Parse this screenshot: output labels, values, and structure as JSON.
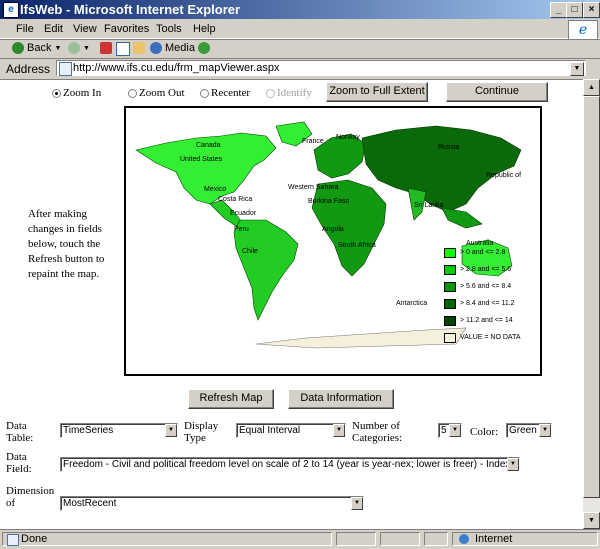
{
  "window": {
    "title": "IfsWeb - Microsoft Internet Explorer",
    "min": "_",
    "max": "□",
    "close": "×"
  },
  "menu": [
    "File",
    "Edit",
    "View",
    "Favorites",
    "Tools",
    "Help"
  ],
  "toolbar": {
    "back": "Back",
    "media": "Media"
  },
  "address": {
    "label": "Address",
    "url": "http://www.ifs.cu.edu/frm_mapViewer.aspx"
  },
  "mode": {
    "zoom_in": "Zoom In",
    "zoom_out": "Zoom Out",
    "recenter": "Recenter",
    "identify": "Identify",
    "selected": "zoom_in"
  },
  "buttons": {
    "full_extent": "Zoom to Full Extent",
    "continue": "Continue",
    "refresh": "Refresh Map",
    "data_info": "Data Information"
  },
  "note": "After making changes in fields below, touch the Refresh button to repaint the map.",
  "map": {
    "labels": [
      "Canada",
      "United States",
      "Mexico",
      "Costa Rica",
      "Ecuador",
      "Peru",
      "Chile",
      "France",
      "Norway",
      "Western Sahara",
      "Burkina Faso",
      "Angola",
      "South Africa",
      "Russia",
      "Sri Lanka",
      "Australia",
      "Antarctica",
      "Republic of"
    ],
    "legend": [
      {
        "label": "> 0 and <= 2.8",
        "color": "#00ff00"
      },
      {
        "label": "> 2.8 and <= 5.6",
        "color": "#00cc00"
      },
      {
        "label": "> 5.6 and <= 8.4",
        "color": "#009900"
      },
      {
        "label": "> 8.4 and <= 11.2",
        "color": "#006600"
      },
      {
        "label": "> 11.2 and <= 14",
        "color": "#004400"
      },
      {
        "label": "VALUE = NO DATA",
        "color": "#f5f0dc"
      }
    ]
  },
  "form": {
    "data_table_label": "Data Table:",
    "data_table_value": "TimeSeries",
    "display_type_label": "Display Type",
    "display_type_value": "Equal Interval",
    "num_categories_label": "Number of Categories:",
    "num_categories_value": "5",
    "color_label": "Color:",
    "color_value": "Green",
    "data_field_label": "Data Field:",
    "data_field_value": "Freedom - Civil and political freedom level on scale of 2 to 14 (year is year-nex; lower is freer) - Index",
    "dimension_label": "Dimension of",
    "dimension_value": "MostRecent"
  },
  "status": {
    "left": "Done",
    "zone": "Internet"
  }
}
